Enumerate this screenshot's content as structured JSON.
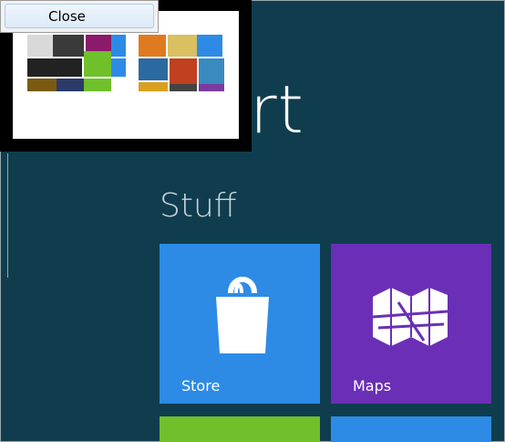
{
  "context_menu": {
    "close_label": "Close"
  },
  "start_screen": {
    "title": "Start",
    "visible_title_fragment": "rt"
  },
  "group": {
    "title": "Stuff"
  },
  "tiles": [
    {
      "label": "Store",
      "icon": "shopping-bag-icon",
      "color": "#2d8be6"
    },
    {
      "label": "Maps",
      "icon": "folded-map-icon",
      "color": "#6a2fb6"
    },
    {
      "label": "",
      "icon": "",
      "color": "#6fc02a"
    },
    {
      "label": "",
      "icon": "",
      "color": "#2d8be6"
    }
  ],
  "colors": {
    "background": "#0f3d4e",
    "thumbnail_border": "#000000",
    "thumbnail_fill": "#ffffff"
  }
}
